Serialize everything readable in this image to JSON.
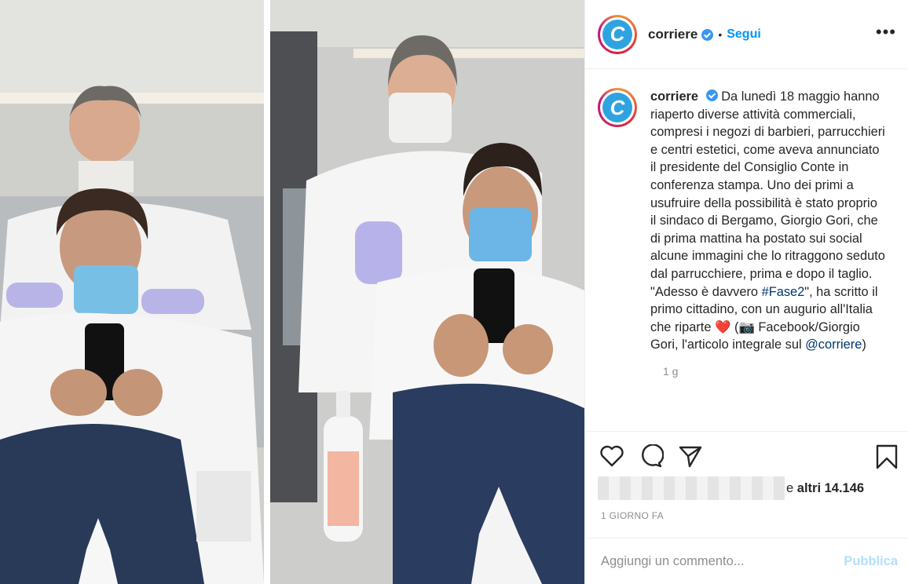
{
  "post": {
    "username": "corriere",
    "avatar_letter": "C",
    "follow_label": "Segui",
    "separator": "•",
    "more_label": "•••",
    "caption": {
      "username": "corriere",
      "text_before_hashtag": "Da lunedì 18 maggio hanno riaperto diverse attività commerciali, compresi i negozi di barbieri, parrucchieri e centri estetici, come aveva annunciato il presidente del Consiglio Conte in conferenza stampa. Uno dei primi a usufruire della possibilità è stato proprio il sindaco di Bergamo, Giorgio Gori, che di prima mattina ha postato sui social alcune immagini che lo ritraggono seduto dal parrucchiere, prima e dopo il taglio. \"Adesso è davvero ",
      "hashtag": "#Fase2",
      "text_after_hashtag": "\", ha scritto il primo cittadino, con un augurio all'Italia che riparte",
      "heart": "❤️",
      "text_after_heart": " (📷 Facebook/Giorgio Gori, l'articolo integrale sul ",
      "mention": "@corriere",
      "text_end": ")"
    },
    "caption_time": "1 g",
    "likes": {
      "prefix": "e ",
      "bold": "altri 14.146"
    },
    "date": "1 GIORNO FA",
    "comment_placeholder": "Aggiungi un commento...",
    "publish_label": "Pubblica"
  },
  "icons": [
    "heart-icon",
    "comment-icon",
    "share-icon",
    "bookmark-icon",
    "verified-icon"
  ],
  "colors": {
    "accent": "#0095f6",
    "verified": "#3897f0",
    "muted": "#8e8e8e",
    "publish_disabled": "#b2dffc",
    "link": "#00376b"
  }
}
